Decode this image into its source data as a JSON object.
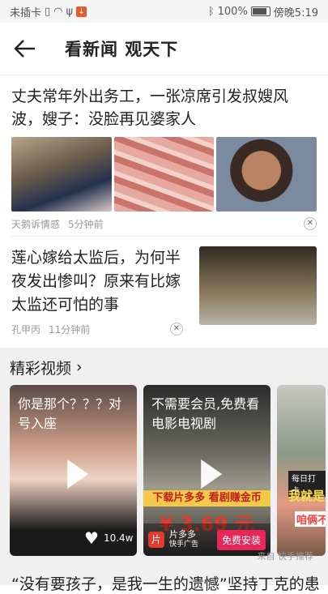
{
  "status": {
    "carrier": "未插卡",
    "battery": "100%",
    "time": "傍晚5:19"
  },
  "header": {
    "title": "看新闻 观天下"
  },
  "article1": {
    "title": "丈夫常年外出务工，一张凉席引发叔嫂风波，嫂子：没脸再见婆家人",
    "source": "天鹅诉情感",
    "time": "5分钟前"
  },
  "article2": {
    "title": "莲心嫁给太监后，为何半夜发出惨叫？原来有比嫁太监还可怕的事",
    "source": "孔甲丙",
    "time": "11分钟前"
  },
  "videos": {
    "section_title": "精彩视频",
    "items": [
      {
        "caption": "你是那个？？？对号入座",
        "likes": "10.4w"
      },
      {
        "caption": "不需要会员,免费看电影电视剧",
        "banner": "下载片多多 看剧赚金币",
        "price": "¥ 3.69 元",
        "app": "片多多",
        "ad_note": "快手广告",
        "install": "免费安装"
      },
      {
        "tag1": "每日打卡",
        "tag2": "我就是",
        "tag3": "咱俩不"
      }
    ],
    "source_note": "来自 快手推荐"
  },
  "next_article": {
    "title": "“没有要孩子，是我一生的遗憾”坚持丁克的患"
  }
}
